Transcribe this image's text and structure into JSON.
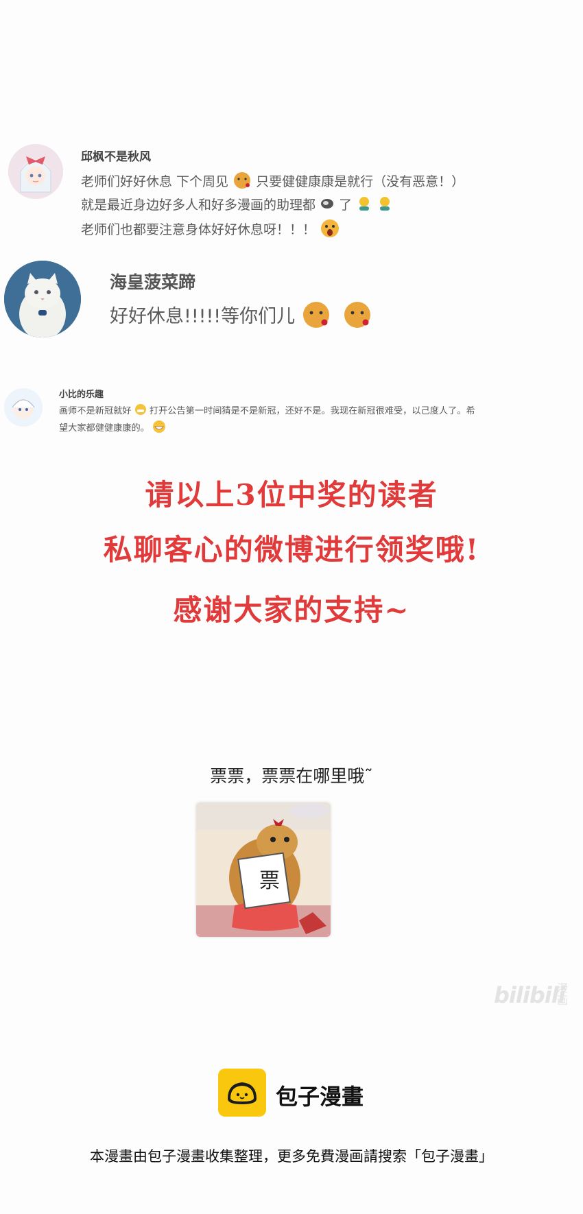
{
  "comments": [
    {
      "name": "邱枫不是秋风",
      "lines": [
        "老师们好好休息 下个周见",
        "只要健健康康是就行（没有恶意！）",
        "就是最近身边好多人和好多漫画的助理都",
        "了",
        "老师们也都要注意身体好好休息呀！！！"
      ]
    },
    {
      "name": "海皇菠菜蹄",
      "text": "好好休息!!!!!等你们儿"
    },
    {
      "name": "小比的乐趣",
      "line1a": "画师不是新冠就好",
      "line1b": "打开公告第一时间猜是不是新冠，还好不是。我现在新冠很难受，以己度人了。希",
      "line2": "望大家都健健康康的。"
    }
  ],
  "announcement": {
    "line1": "请以上3位中奖的读者",
    "line2": "私聊客心的微博进行领奖哦!",
    "line3": "感谢大家的支持~"
  },
  "ticket_prompt": "票票，票票在哪里哦˜",
  "sticker_text": "票",
  "watermark": {
    "bili": "bilibili",
    "manhua_1": "漫",
    "manhua_2": "画"
  },
  "footer": {
    "brand": "包子漫畫",
    "note": "本漫畫由包子漫畫收集整理，更多免費漫画請搜索「包子漫畫」"
  },
  "colors": {
    "announcement_red": "#e03a3a",
    "brand_yellow": "#f9c80e"
  }
}
